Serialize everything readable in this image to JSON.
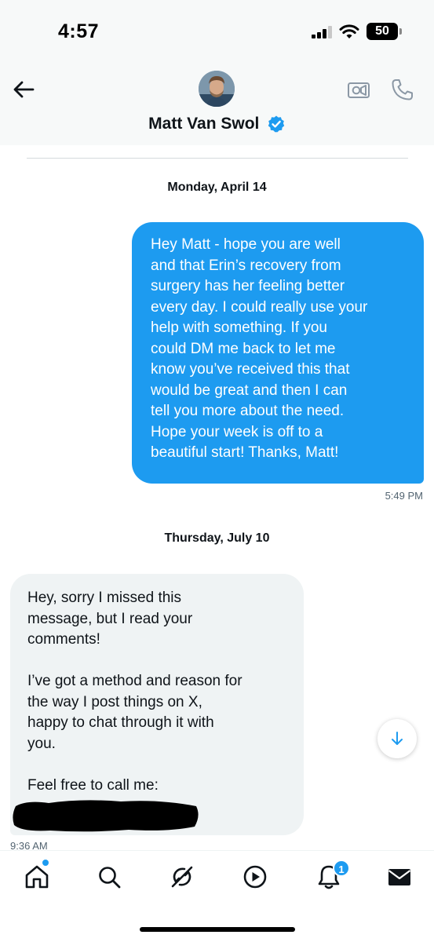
{
  "status_bar": {
    "time": "4:57",
    "battery": "50"
  },
  "header": {
    "contact_name": "Matt Van Swol",
    "verified": true,
    "icons": [
      "back-arrow-icon",
      "video-camera-icon",
      "phone-icon",
      "verified-badge-icon"
    ]
  },
  "conversation": {
    "groups": [
      {
        "date": "Monday, April 14",
        "messages": [
          {
            "direction": "outgoing",
            "text": "Hey Matt - hope you are well\nand that Erin’s recovery from\nsurgery has her feeling better\nevery day. I could really use your\nhelp with something. If you\ncould DM me back to let me\nknow you’ve received this that\nwould be great and then I can\ntell you more about the need.\nHope your week is off to a\nbeautiful start! Thanks, Matt!",
            "time": "5:49 PM"
          }
        ]
      },
      {
        "date": "Thursday, July 10",
        "messages": [
          {
            "direction": "incoming",
            "text": "Hey, sorry I missed this\nmessage, but I read your\ncomments!\n\nI’ve got a method and reason for\nthe way I post things on X,\nhappy to chat through it with\nyou.\n\nFeel free to call me:",
            "redacted": true,
            "time": "9:36 AM"
          }
        ]
      }
    ]
  },
  "bottom_nav": {
    "items": [
      "home-icon",
      "search-icon",
      "grok-icon",
      "video-icon",
      "notifications-icon",
      "messages-icon"
    ],
    "active": "home",
    "notification_count": "1"
  },
  "colors": {
    "accent": "#1d9bf0",
    "incoming_bubble": "#eff3f4",
    "background": "#ffffff",
    "header_background": "#f7f9f9"
  }
}
